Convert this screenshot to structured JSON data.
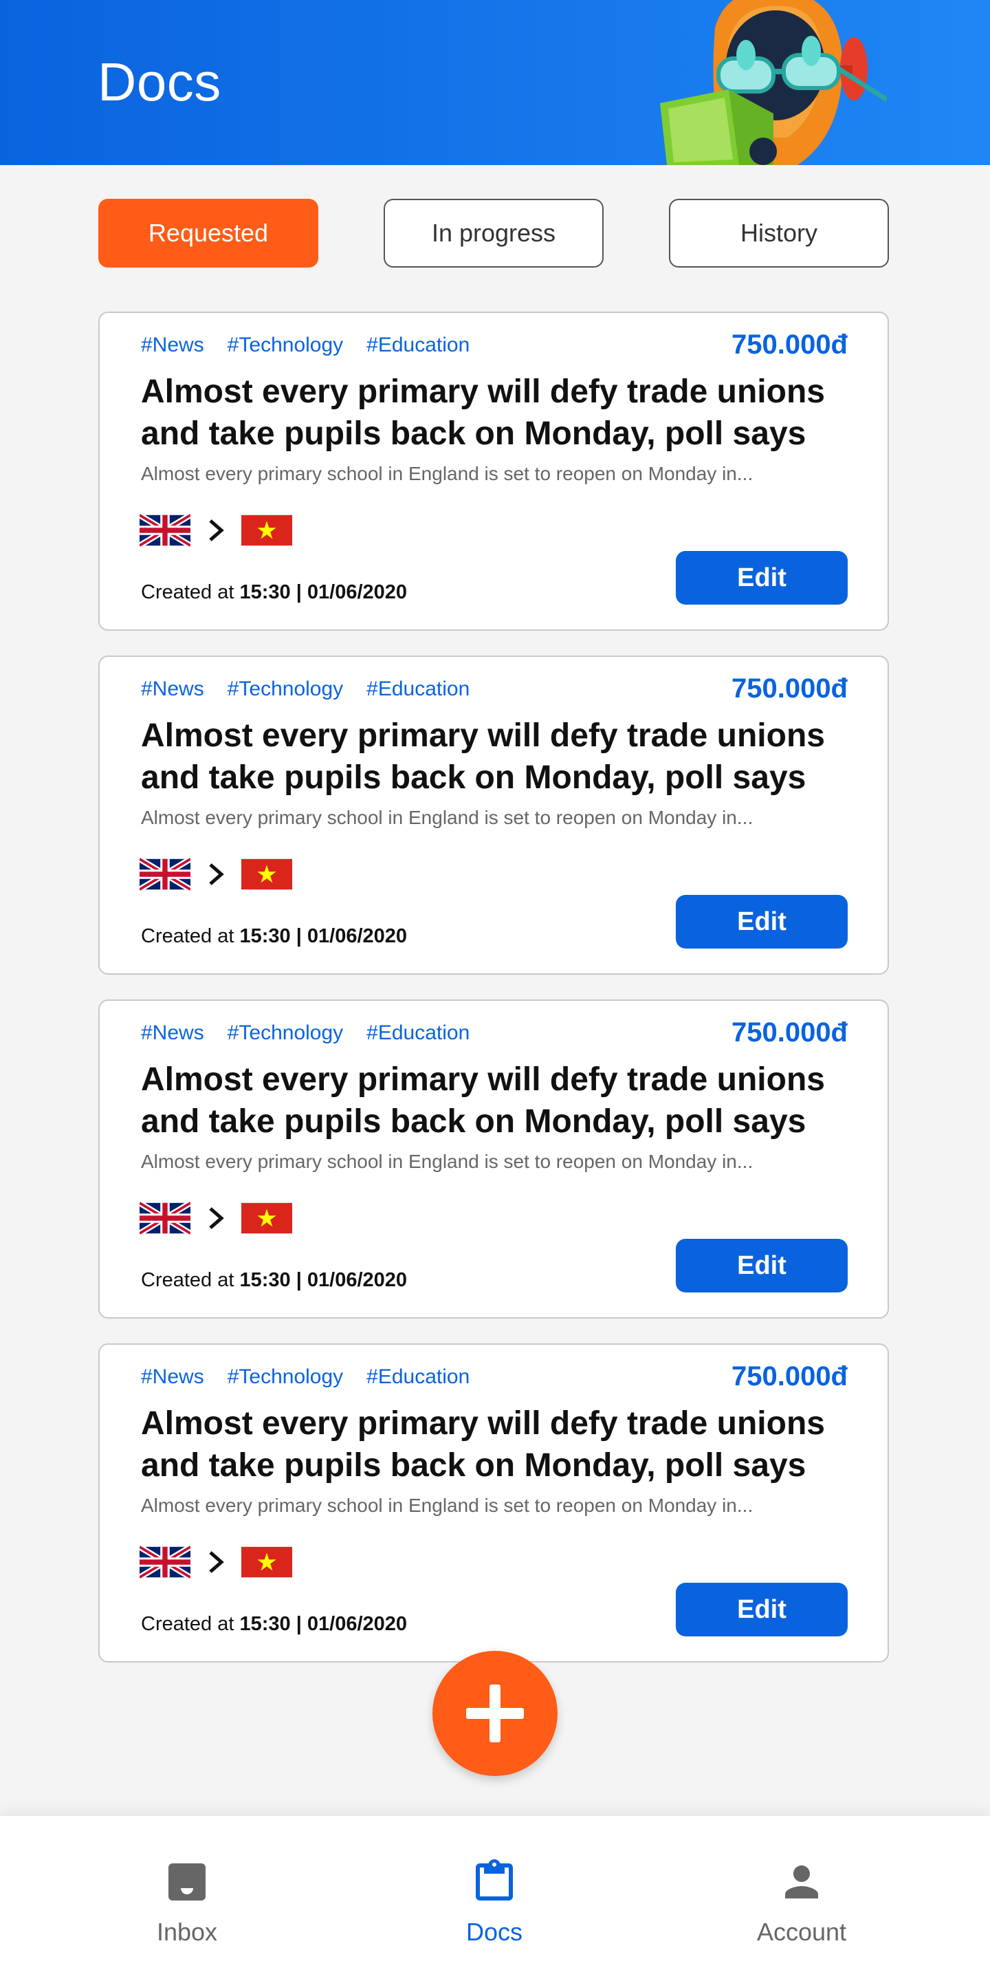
{
  "header": {
    "title": "Docs"
  },
  "tabs": [
    {
      "label": "Requested",
      "active": true
    },
    {
      "label": "In progress",
      "active": false
    },
    {
      "label": "History",
      "active": false
    }
  ],
  "cards": [
    {
      "tags": [
        "#News",
        "#Technology",
        "#Education"
      ],
      "price": "750.000đ",
      "title": "Almost every primary will defy trade unions and take pupils back on Monday, poll says",
      "excerpt": "Almost every primary school in England is set to reopen on Monday in...",
      "source_flag": "uk-flag-icon",
      "target_flag": "vietnam-flag-icon",
      "created_label": "Created at",
      "created_time": "15:30",
      "created_date": "01/06/2020",
      "edit_label": "Edit"
    },
    {
      "tags": [
        "#News",
        "#Technology",
        "#Education"
      ],
      "price": "750.000đ",
      "title": "Almost every primary will defy trade unions and take pupils back on Monday, poll says",
      "excerpt": "Almost every primary school in England is set to reopen on Monday in...",
      "source_flag": "uk-flag-icon",
      "target_flag": "vietnam-flag-icon",
      "created_label": "Created at",
      "created_time": "15:30",
      "created_date": "01/06/2020",
      "edit_label": "Edit"
    },
    {
      "tags": [
        "#News",
        "#Technology",
        "#Education"
      ],
      "price": "750.000đ",
      "title": "Almost every primary will defy trade unions and take pupils back on Monday, poll says",
      "excerpt": "Almost every primary school in England is set to reopen on Monday in...",
      "source_flag": "uk-flag-icon",
      "target_flag": "vietnam-flag-icon",
      "created_label": "Created at",
      "created_time": "15:30",
      "created_date": "01/06/2020",
      "edit_label": "Edit"
    },
    {
      "tags": [
        "#News",
        "#Technology",
        "#Education"
      ],
      "price": "750.000đ",
      "title": "Almost every primary will defy trade unions and take pupils back on Monday, poll says",
      "excerpt": "Almost every primary school in England is set to reopen on Monday in...",
      "source_flag": "uk-flag-icon",
      "target_flag": "vietnam-flag-icon",
      "created_label": "Created at",
      "created_time": "15:30",
      "created_date": "01/06/2020",
      "edit_label": "Edit"
    }
  ],
  "fab": {
    "icon": "plus-icon"
  },
  "bottom_nav": [
    {
      "label": "Inbox",
      "icon": "inbox-icon",
      "active": false
    },
    {
      "label": "Docs",
      "icon": "clipboard-icon",
      "active": true
    },
    {
      "label": "Account",
      "icon": "person-icon",
      "active": false
    }
  ],
  "colors": {
    "primary_blue": "#0a63de",
    "accent_orange": "#fe5c17",
    "background": "#f4f4f4"
  }
}
